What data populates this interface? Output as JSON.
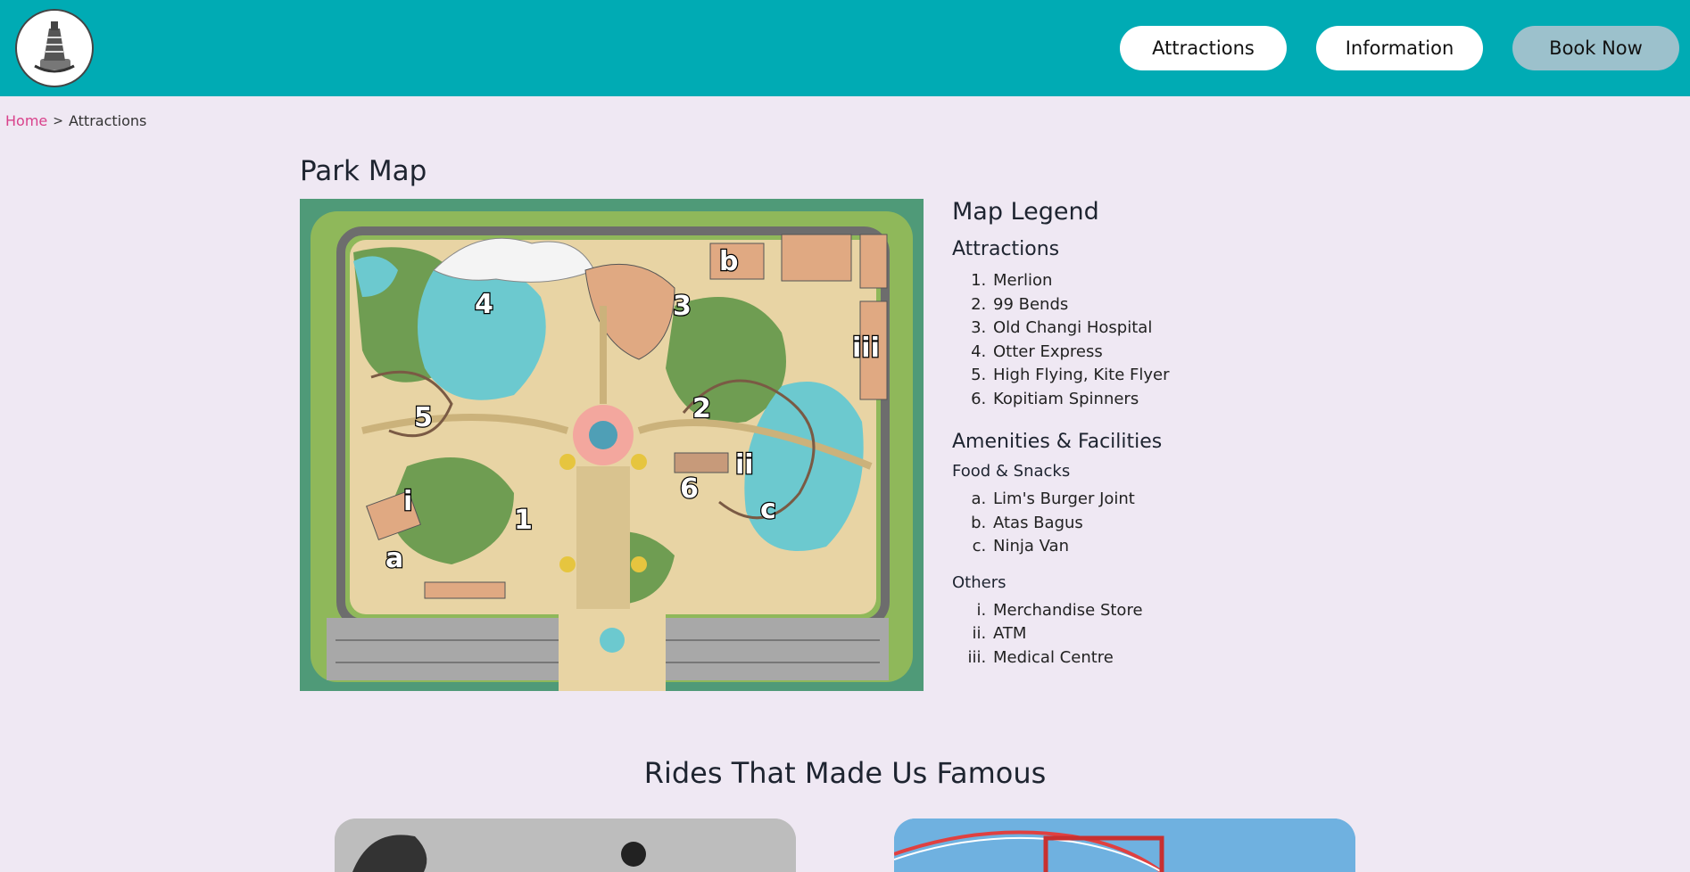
{
  "header": {
    "logo_icon": "ferris-tower-logo",
    "nav": {
      "attractions": "Attractions",
      "information": "Information",
      "book_now": "Book Now"
    },
    "colors": {
      "bar": "#00abb4",
      "button": "#ffffff",
      "book_button": "#9cc1cc"
    }
  },
  "breadcrumb": {
    "home": "Home",
    "separator": ">",
    "current": "Attractions"
  },
  "park_map": {
    "title": "Park Map",
    "markers": {
      "attractions": [
        "1",
        "2",
        "3",
        "4",
        "5",
        "6"
      ],
      "food": [
        "a",
        "b",
        "c"
      ],
      "others": [
        "i",
        "ii",
        "iii"
      ]
    }
  },
  "legend": {
    "title": "Map Legend",
    "attractions_title": "Attractions",
    "attractions": [
      "Merlion",
      "99 Bends",
      "Old Changi Hospital",
      "Otter Express",
      "High Flying, Kite Flyer",
      "Kopitiam Spinners"
    ],
    "amenities_title": "Amenities & Facilities",
    "food_title": "Food & Snacks",
    "food": [
      "Lim's Burger Joint",
      "Atas Bagus",
      "Ninja Van"
    ],
    "others_title": "Others",
    "others": [
      "Merchandise Store",
      "ATM",
      "Medical Centre"
    ]
  },
  "rides": {
    "title": "Rides That Made Us Famous"
  }
}
